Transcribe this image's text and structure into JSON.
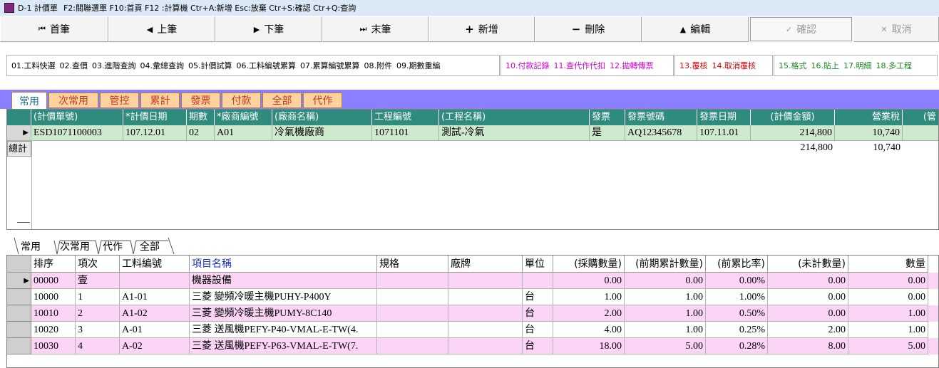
{
  "window": {
    "title": "D-1 計價單",
    "hotkeys": "F2:關聯選單  F10:首頁  F12 :計算機  Ctr+A:新增  Esc:放棄  Ctr+S:確認  Ctr+Q:查詢"
  },
  "toolbar": {
    "first": "首筆",
    "prev": "上筆",
    "next": "下筆",
    "last": "末筆",
    "add": "新增",
    "delete": "刪除",
    "edit": "編輯",
    "confirm": "確認",
    "cancel": "取消",
    "icons": {
      "first": "⏮",
      "prev": "◀",
      "next": "▶",
      "last": "⏭",
      "add": "+",
      "delete": "−",
      "edit": "▲",
      "confirm": "✓",
      "cancel": "✕"
    }
  },
  "funcbar": {
    "group1": [
      "01.工料快選",
      "02.查價",
      "03.進階查詢",
      "04.彙總查詢",
      "05.計價試算",
      "06.工料編號累算",
      "07.累算編號累算",
      "08.附件",
      "09.期數重編"
    ],
    "group2": [
      "10.付款記錄",
      "11.查代作代扣",
      "12.拋轉傳票"
    ],
    "group3": [
      "13.覆核",
      "14.取消覆核"
    ],
    "group4": [
      "15.格式",
      "16.貼上",
      "17.明細",
      "18.多工程"
    ],
    "colors": {
      "group1": "#000000",
      "group2": "#cc00cc",
      "group3": "#d40000",
      "group4": "#1a8a1a"
    }
  },
  "top_tabs": [
    "常用",
    "次常用",
    "管控",
    "累計",
    "發票",
    "付款",
    "全部",
    "代作"
  ],
  "top_grid": {
    "headers": [
      "(計價單號)",
      "*計價日期",
      "期數",
      "*廠商編號",
      "(廠商名稱)",
      "工程編號",
      "(工程名稱)",
      "發票",
      "發票號碼",
      "發票日期",
      "(計價金額)",
      "營業稅",
      "(管"
    ],
    "row": [
      "ESD1071100003",
      "107.12.01",
      "02",
      "A01",
      "冷氣機廠商",
      "1071101",
      "測試-冷氣",
      "是",
      "AQ12345678",
      "107.11.01",
      "214,800",
      "10,740"
    ],
    "total_label": "總計",
    "total_amount": "214,800",
    "total_tax": "10,740"
  },
  "bottom_tabs": [
    "常用",
    "次常用",
    "代作",
    "全部"
  ],
  "bottom_grid": {
    "headers": [
      "排序",
      "項次",
      "工料編號",
      "項目名稱",
      "規格",
      "廠牌",
      "單位",
      "(採購數量)",
      "(前期累計數量)",
      "(前累比率)",
      "(未計數量)",
      "數量"
    ],
    "rows": [
      [
        "00000",
        "壹",
        "",
        "機器設備",
        "",
        "",
        "",
        "0.00",
        "0.00",
        "0.00%",
        "0.00",
        "0.00"
      ],
      [
        "10000",
        "1",
        "A1-01",
        "三菱 變頻冷暖主機PUHY-P400Y",
        "",
        "",
        "台",
        "1.00",
        "1.00",
        "1.00%",
        "0.00",
        "0.00"
      ],
      [
        "10010",
        "2",
        "A1-02",
        "三菱 變頻冷暖主機PUMY-8C140",
        "",
        "",
        "台",
        "2.00",
        "1.00",
        "0.50%",
        "0.00",
        "1.00"
      ],
      [
        "10020",
        "3",
        "A-01",
        "三菱 送風機PEFY-P40-VMAL-E-TW(4.",
        "",
        "",
        "台",
        "4.00",
        "1.00",
        "0.25%",
        "2.00",
        "1.00"
      ],
      [
        "10030",
        "4",
        "A-02",
        "三菱 送風機PEFY-P63-VMAL-E-TW(7.",
        "",
        "",
        "台",
        "18.00",
        "5.00",
        "0.28%",
        "8.00",
        "5.00"
      ]
    ]
  }
}
